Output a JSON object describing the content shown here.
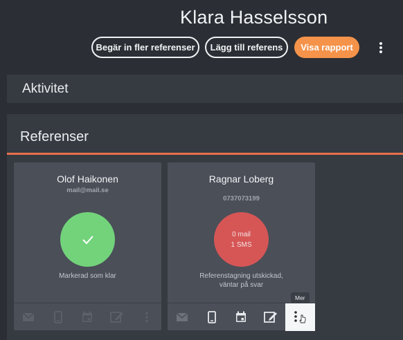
{
  "header": {
    "title": "Klara Hasselsson",
    "btn_request_more": "Begär in fler referenser",
    "btn_add_reference": "Lägg till referens",
    "btn_show_report": "Visa rapport"
  },
  "sections": {
    "aktivitet": "Aktivitet",
    "referenser": "Referenser"
  },
  "cards": [
    {
      "name": "Olof Haikonen",
      "contact": "mail@mail.se",
      "circle_color": "#73d37b",
      "circle_icon": "check-icon",
      "status": "Markerad som klar",
      "footer_icons": [
        "mail-icon",
        "phone-icon",
        "calendar-icon",
        "edit-icon",
        "more-vertical-icon"
      ],
      "footer_active": false
    },
    {
      "name": "Ragnar Loberg",
      "contact": "0737073199",
      "circle_color": "#d65656",
      "circle_line1": "0 mail",
      "circle_line2": "1 SMS",
      "status_line1": "Referenstagning utskickad,",
      "status_line2": "väntar på svar",
      "footer_icons": [
        "mail-icon",
        "phone-icon",
        "calendar-icon",
        "edit-icon",
        "more-vertical-icon"
      ],
      "footer_active": true
    }
  ],
  "tooltip": "Mer",
  "colors": {
    "accent": "#e8704a",
    "primary_button": "#f5934a",
    "done": "#73d37b",
    "pending": "#d65656"
  }
}
